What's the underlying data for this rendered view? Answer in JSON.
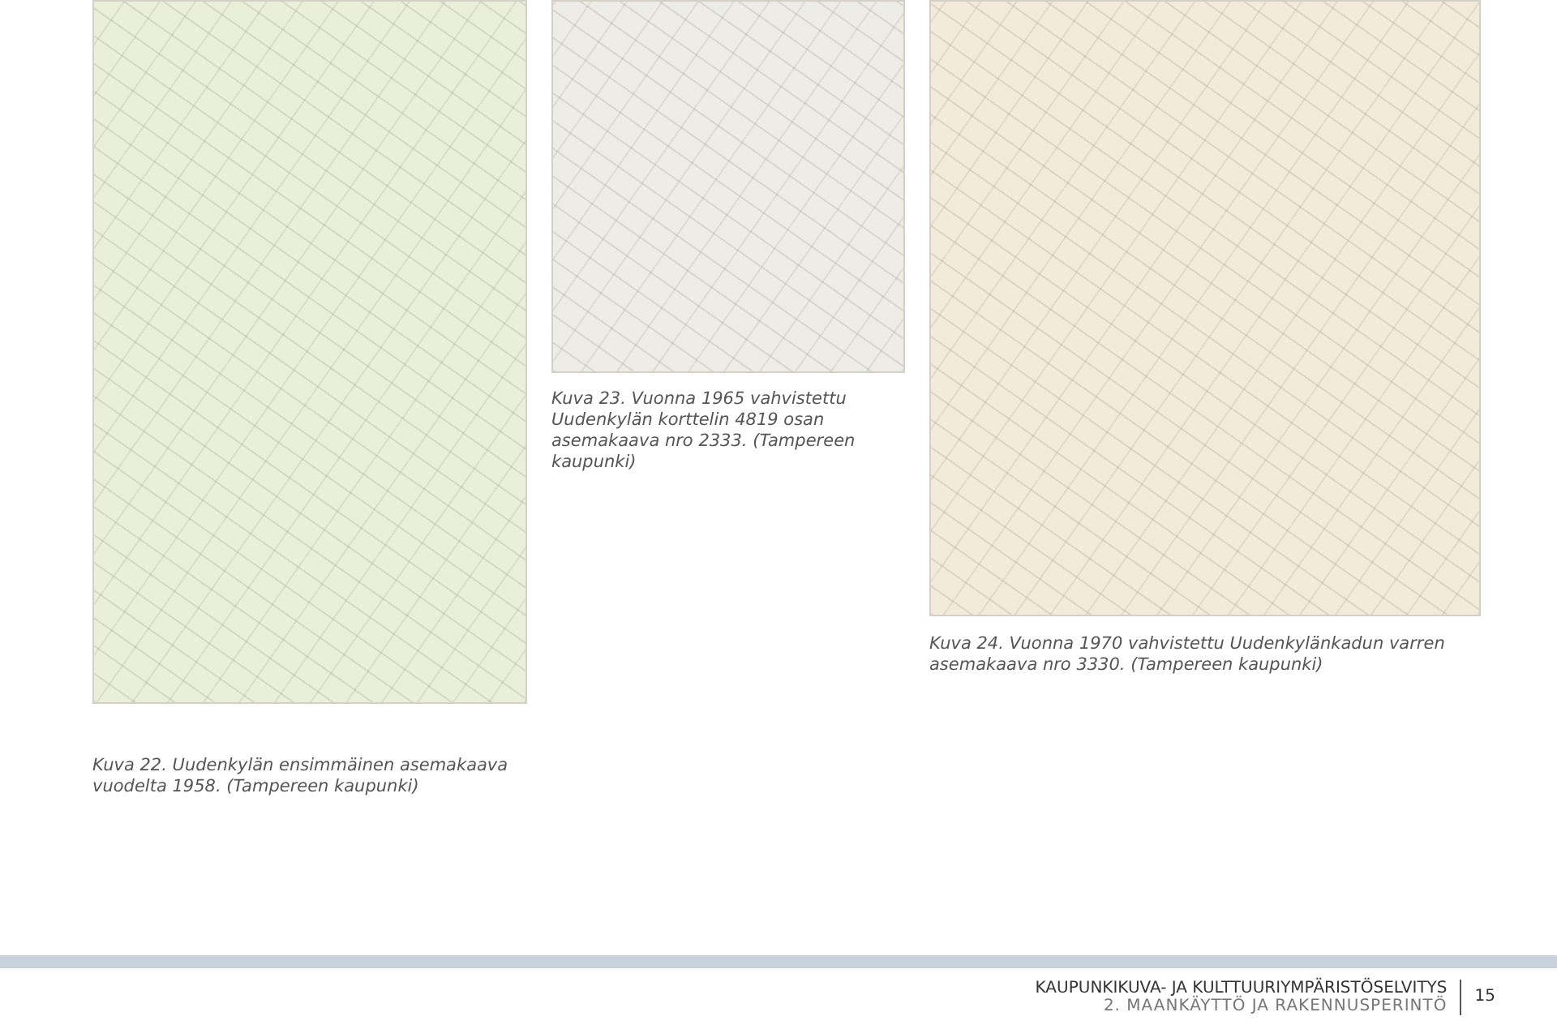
{
  "figures": [
    {
      "caption": "Kuva 22. Uudenkylän ensimmäinen asemakaava vuodelta 1958. (Tampereen kaupunki)"
    },
    {
      "caption": "Kuva 23. Vuonna 1965 vahvistettu Uudenkylän korttelin 4819 osan asemakaava nro 2333. (Tampereen kaupunki)"
    },
    {
      "caption": "Kuva 24. Vuonna 1970 vahvistettu Uudenkylänkadun varren asemakaava nro 3330. (Tampereen kaupunki)"
    }
  ],
  "footer": {
    "title": "KAUPUNKIKUVA- JA KULTTUURIYMPÄRISTÖSELVITYS",
    "subtitle": "2. MAANKÄYTTÖ JA RAKENNUSPERINTÖ",
    "page": "15"
  }
}
